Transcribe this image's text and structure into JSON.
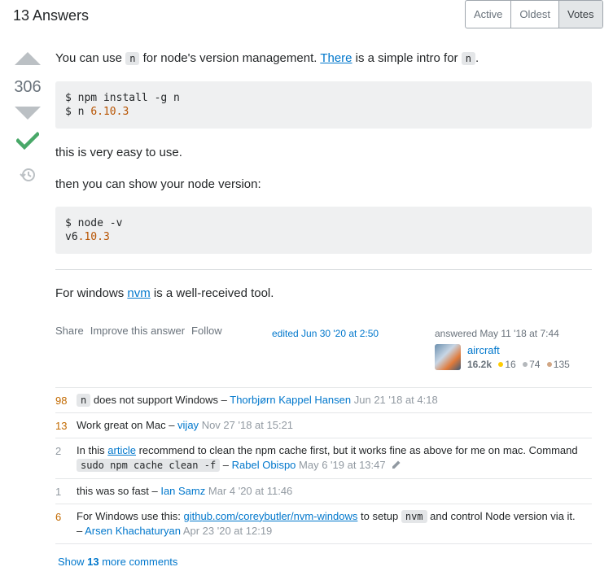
{
  "header": {
    "title": "13 Answers"
  },
  "sort": {
    "tabs": [
      "Active",
      "Oldest",
      "Votes"
    ],
    "active": "Votes"
  },
  "votes": {
    "count": "306"
  },
  "answer": {
    "p1_pre": "You can use ",
    "p1_code": "n",
    "p1_mid": " for node's version management. ",
    "p1_link": "There",
    "p1_post": " is a simple intro for ",
    "p1_code2": "n",
    "p1_end": ".",
    "code1_line1": "$ npm install -g n",
    "code1_line2_pre": "$ n ",
    "code1_line2_num": "6.10.3",
    "p2": "this is very easy to use.",
    "p3": "then you can show your node version:",
    "code2_line1": "$ node -v",
    "code2_line2_pre": "v6",
    "code2_line2_num": ".10.3",
    "p4_pre": "For windows ",
    "p4_link": "nvm",
    "p4_post": " is a well-received tool."
  },
  "menu": {
    "share": "Share",
    "improve": "Improve this answer",
    "follow": "Follow"
  },
  "edited": "edited Jun 30 '20 at 2:50",
  "author": {
    "answered": "answered May 11 '18 at 7:44",
    "name": "aircraft",
    "rep": "16.2k",
    "gold": "16",
    "silver": "74",
    "bronze": "135",
    "colors": {
      "gold": "#ffcc01",
      "silver": "#b4b8bc",
      "bronze": "#d1a684"
    }
  },
  "comments": [
    {
      "score": "98",
      "code": "n",
      "text": " does not support Windows – ",
      "user": "Thorbjørn Kappel Hansen",
      "date": "Jun 21 '18 at 4:18"
    },
    {
      "score": "13",
      "text": "Work great on Mac – ",
      "user": "vijay",
      "date": "Nov 27 '18 at 15:21"
    },
    {
      "score": "2",
      "pre": "In this ",
      "link": "article",
      "mid": " recommend to clean the npm cache first, but it works fine as above for me on mac. Command ",
      "code": "sudo npm cache clean -f",
      "dash": " – ",
      "user": "Rabel Obispo",
      "date": "May 6 '19 at 13:47"
    },
    {
      "score": "1",
      "text": "this was so fast – ",
      "user": "Ian Samz",
      "date": "Mar 4 '20 at 11:46"
    },
    {
      "score": "6",
      "pre": "For Windows use this: ",
      "link": "github.com/coreybutler/nvm-windows",
      "mid": " to setup ",
      "code": "nvm",
      "post": " and control Node version via it.",
      "dash": "– ",
      "user": "Arsen Khachaturyan",
      "date": "Apr 23 '20 at 12:19"
    }
  ],
  "show_more": {
    "pre": "Show ",
    "count": "13",
    "post": " more comments"
  }
}
